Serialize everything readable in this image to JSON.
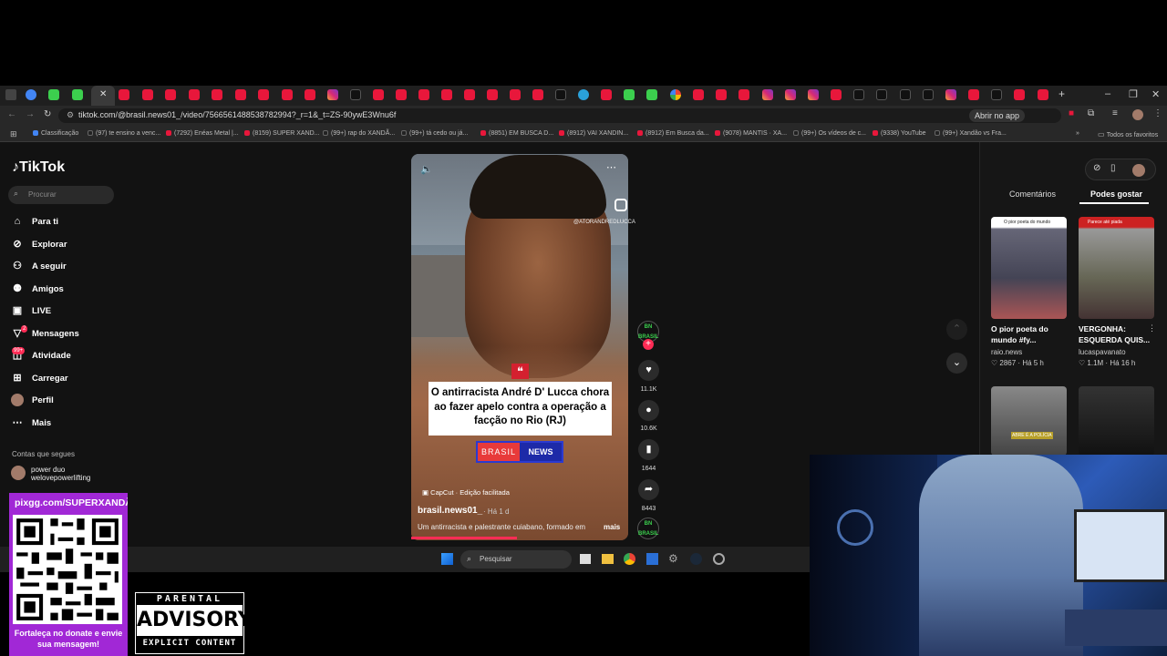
{
  "browser": {
    "url": "tiktok.com/@brasil.news01_/video/7566561488538782994?_r=1&_t=ZS-90ywE3Wnu6f",
    "open_app": "Abrir no app",
    "bookmarks": [
      "Classificação",
      "(97) te ensino a venc...",
      "(7292) Enéas Metal |...",
      "(8159) SUPER XAND...",
      "(99+) rap do XANDÃ...",
      "(99+) tá cedo ou já...",
      "(8851) EM BUSCA D...",
      "(8912) VAI XANDIN...",
      "(8912) Em Busca da...",
      "(9078) MANTIS · XA...",
      "(99+) Os vídeos de c...",
      "(9338) YouTube",
      "(99+) Xandão vs Fra..."
    ],
    "all_favorites": "Todos os favoritos"
  },
  "sidebar": {
    "logo": "TikTok",
    "search_placeholder": "Procurar",
    "items": [
      {
        "label": "Para ti",
        "icon": "home-icon"
      },
      {
        "label": "Explorar",
        "icon": "compass-icon"
      },
      {
        "label": "A seguir",
        "icon": "following-icon"
      },
      {
        "label": "Amigos",
        "icon": "friends-icon"
      },
      {
        "label": "LIVE",
        "icon": "live-icon"
      },
      {
        "label": "Mensagens",
        "icon": "messages-icon",
        "badge": "2"
      },
      {
        "label": "Atividade",
        "icon": "activity-icon",
        "badge": "99+"
      },
      {
        "label": "Carregar",
        "icon": "upload-icon"
      },
      {
        "label": "Perfil",
        "icon": "profile-icon"
      },
      {
        "label": "Mais",
        "icon": "more-icon"
      }
    ],
    "following_title": "Contas que segues",
    "following": [
      {
        "name": "power duo",
        "handle": "welovepowerlifting"
      }
    ]
  },
  "video": {
    "quote": "O antirracista André D' Lucca chora ao fazer apelo contra a operação a facção no Rio (RJ)",
    "brand_a": "BRASIL",
    "brand_b": "NEWS",
    "watermark": "@ATORANDREDLUCCA",
    "capcut": "CapCut · Edição facilitada",
    "author": "brasil.news01_",
    "ago": "· Há 1 d",
    "description": "Um antirracista e palestrante cuiabano, formado em",
    "more": "mais",
    "avatar_text": "BN BRASIL",
    "likes": "11.1K",
    "comments": "10.6K",
    "saves": "1644",
    "shares": "8443"
  },
  "right_panel": {
    "tab_comments": "Comentários",
    "tab_likes": "Podes gostar",
    "cards": [
      {
        "title": "O pior poeta do mundo #fy...",
        "user": "raio.news",
        "likes": "2867",
        "ago": "Há 5 h",
        "caption": "O pior poeta do mundo"
      },
      {
        "title": "VERGONHA: ESQUERDA QUIS...",
        "user": "lucaspavanato",
        "likes": "1.1M",
        "ago": "Há 16 h",
        "caption": "Parece até piada"
      }
    ],
    "card3_caption": "ABRE É A POLÍCIA"
  },
  "taskbar": {
    "search": "Pesquisar"
  },
  "overlay": {
    "qr_url": "pixgg.com/SUPERXANDÃO",
    "qr_caption": "Fortaleça no donate e envie sua mensagem!",
    "parental": "PARENTAL",
    "advisory": "ADVISORY",
    "explicit": "EXPLICIT CONTENT"
  }
}
